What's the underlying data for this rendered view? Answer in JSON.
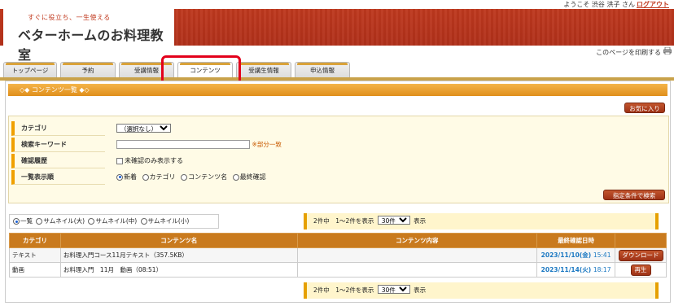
{
  "header": {
    "tagline": "すぐに役立ち、一生使える",
    "logo": "ベターホームのお料理教室",
    "welcome": "ようこそ 渋谷 洪子 さん",
    "logout": "ログアウト",
    "print": "このページを印刷する"
  },
  "tabs": [
    {
      "label": "トップページ"
    },
    {
      "label": "予約"
    },
    {
      "label": "受講情報"
    },
    {
      "label": "コンテンツ"
    },
    {
      "label": "受講生情報"
    },
    {
      "label": "申込情報"
    }
  ],
  "section": {
    "title": "◇◆ コンテンツ一覧 ◆◇",
    "favorite_button": "お気に入り"
  },
  "search": {
    "category_label": "カテゴリ",
    "category_value": "（選択なし）",
    "keyword_label": "検索キーワード",
    "keyword_value": "",
    "keyword_hint": "※部分一致",
    "history_label": "確認履歴",
    "history_checkbox": "未確認のみ表示する",
    "order_label": "一覧表示順",
    "order_options": [
      "新着",
      "カテゴリ",
      "コンテンツ名",
      "最終確認"
    ],
    "order_selected": "新着",
    "search_button": "指定条件で検索"
  },
  "view": {
    "options": [
      "一覧",
      "サムネイル(大)",
      "サムネイル(中)",
      "サムネイル(小)"
    ],
    "selected": "一覧"
  },
  "pager": {
    "summary": "2件中　1〜2件を表示",
    "per_page": "30件",
    "suffix": "表示"
  },
  "table": {
    "headers": [
      "カテゴリ",
      "コンテンツ名",
      "コンテンツ内容",
      "最終確認日時",
      ""
    ],
    "rows": [
      {
        "category": "テキスト",
        "name": "お料理入門コース11月テキスト（357.5KB）",
        "content": "",
        "date": "2023/11/10(金)",
        "time": "15:41",
        "action": "ダウンロード"
      },
      {
        "category": "動画",
        "name": "お料理入門　11月　動画（08:51）",
        "content": "",
        "date": "2023/11/14(火)",
        "time": "18:17",
        "action": "再生"
      }
    ]
  },
  "colors": {
    "brand_red": "#c13a1f",
    "accent_orange": "#e08f1b",
    "highlight_red": "#e3001b"
  }
}
